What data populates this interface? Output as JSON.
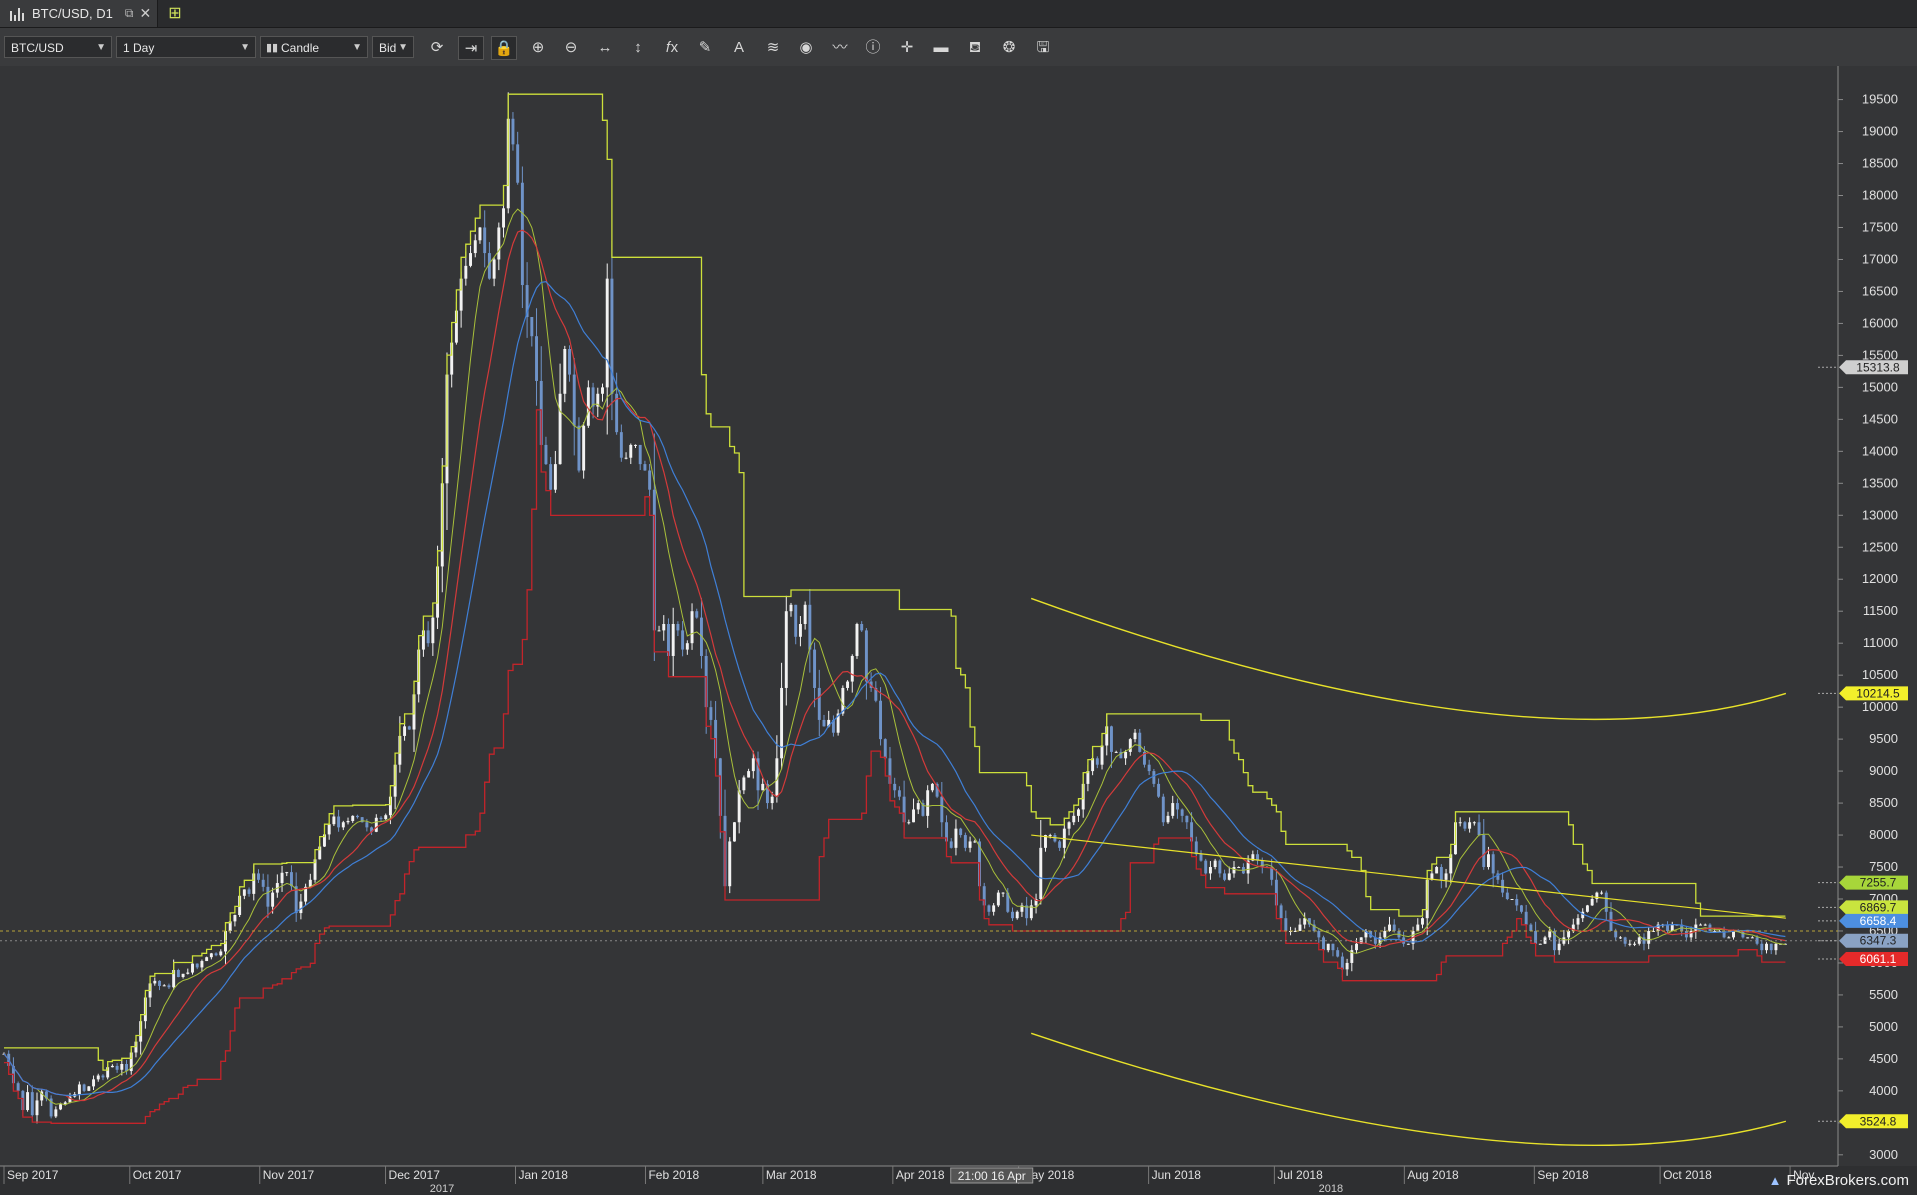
{
  "tab": {
    "title": "BTC/USD, D1",
    "icon": "candlestick-chart-icon",
    "popout_icon": "popout-icon",
    "close_icon": "close-icon"
  },
  "new_tab_icon": "add-chart-icon",
  "toolbar": {
    "symbol": "BTC/USD",
    "timeframe": "1 Day",
    "chart_type": "Candle",
    "price_side": "Bid",
    "buttons": [
      {
        "name": "refresh-icon",
        "glyph": "⟳"
      },
      {
        "name": "shift-chart-icon",
        "glyph": "⇥",
        "active": true
      },
      {
        "name": "lock-icon",
        "glyph": "🔒",
        "active": true
      },
      {
        "name": "zoom-in-icon",
        "glyph": "⊕"
      },
      {
        "name": "zoom-out-icon",
        "glyph": "⊖"
      },
      {
        "name": "fit-horizontal-icon",
        "glyph": "↔"
      },
      {
        "name": "fit-vertical-icon",
        "glyph": "↕"
      },
      {
        "name": "indicators-icon",
        "glyph": "𝑓x"
      },
      {
        "name": "drawing-pencil-icon",
        "glyph": "✎"
      },
      {
        "name": "text-tool-icon",
        "glyph": "A"
      },
      {
        "name": "layers-icon",
        "glyph": "≋"
      },
      {
        "name": "visibility-eye-icon",
        "glyph": "◉"
      },
      {
        "name": "signals-icon",
        "glyph": "〰"
      },
      {
        "name": "info-icon",
        "glyph": "ⓘ"
      },
      {
        "name": "crosshair-icon",
        "glyph": "✛"
      },
      {
        "name": "volume-bar-icon",
        "glyph": "▬"
      },
      {
        "name": "paint-bucket-icon",
        "glyph": "⛾"
      },
      {
        "name": "sync-icon",
        "glyph": "❂"
      },
      {
        "name": "save-icon",
        "glyph": "🖫"
      }
    ]
  },
  "chart_data": {
    "type": "candlestick",
    "symbol": "BTC/USD",
    "timeframe": "D1",
    "ylim": [
      2700,
      19900
    ],
    "y_ticks": [
      3000,
      3500,
      4000,
      4500,
      5000,
      5500,
      6000,
      6500,
      7000,
      7500,
      8000,
      8500,
      9000,
      9500,
      10000,
      10500,
      11000,
      11500,
      12000,
      12500,
      13000,
      13500,
      14000,
      14500,
      15000,
      15500,
      16000,
      16500,
      17000,
      17500,
      18000,
      18500,
      19000,
      19500
    ],
    "x_labels": [
      {
        "label": "Sep 2017",
        "day": 0
      },
      {
        "label": "Oct 2017",
        "day": 30
      },
      {
        "label": "Nov 2017",
        "day": 61
      },
      {
        "label": "Dec 2017",
        "day": 91
      },
      {
        "label": "Jan 2018",
        "day": 122
      },
      {
        "label": "Feb 2018",
        "day": 153
      },
      {
        "label": "Mar 2018",
        "day": 181
      },
      {
        "label": "Apr 2018",
        "day": 212
      },
      {
        "label": "May 2018",
        "day": 242
      },
      {
        "label": "Jun 2018",
        "day": 273
      },
      {
        "label": "Jul 2018",
        "day": 303
      },
      {
        "label": "Aug 2018",
        "day": 334
      },
      {
        "label": "Sep 2018",
        "day": 365
      },
      {
        "label": "Oct 2018",
        "day": 395
      },
      {
        "label": "Nov",
        "day": 426
      }
    ],
    "year_labels": [
      {
        "label": "2017",
        "day": 61
      },
      {
        "label": "2018",
        "day": 273
      }
    ],
    "crosshair_date_label": "21:00 16 Apr",
    "price_tags": [
      {
        "value": 15313.8,
        "label": "15313.8",
        "color": "#cfcfcf",
        "text": "#222"
      },
      {
        "value": 10214.5,
        "label": "10214.5",
        "color": "#f2ef2b",
        "text": "#222"
      },
      {
        "value": 7255.7,
        "label": "7255.7",
        "color": "#a7d63a",
        "text": "#222"
      },
      {
        "value": 6869.7,
        "label": "6869.7",
        "color": "#c9e43e",
        "text": "#222"
      },
      {
        "value": 6658.4,
        "label": "6658.4",
        "color": "#4d8fe0",
        "text": "#fff"
      },
      {
        "value": 6347.3,
        "label": "6347.3",
        "color": "#8aa2c4",
        "text": "#222"
      },
      {
        "value": 6061.1,
        "label": "6061.1",
        "color": "#e52a2a",
        "text": "#fff"
      },
      {
        "value": 3524.8,
        "label": "3524.8",
        "color": "#f2ef2b",
        "text": "#222"
      }
    ],
    "price_line_upper": {
      "x": [
        0,
        60,
        90,
        105,
        120,
        135,
        150,
        170,
        200,
        230,
        260,
        290,
        320,
        350,
        380,
        400,
        415,
        426
      ],
      "y": [
        4300,
        5200,
        7300,
        12500,
        15200,
        14200,
        12000,
        10800,
        8400,
        7200,
        7300,
        6500,
        6300,
        6400,
        6800,
        6900,
        7050,
        7150
      ]
    },
    "channel_upper": {
      "x0": 245,
      "x1": 425,
      "y0": 11700,
      "y_mid": 9650,
      "y1": 10214.5
    },
    "channel_lower": {
      "x0": 245,
      "x1": 425,
      "y0": 4900,
      "y_mid": 3000,
      "y1": 3524.8
    },
    "closes": [
      4580,
      4390,
      4120,
      4000,
      3700,
      3980,
      3620,
      3850,
      3990,
      3880,
      3600,
      3710,
      3790,
      3820,
      3910,
      3950,
      4100,
      4000,
      4070,
      4180,
      4240,
      4210,
      4370,
      4390,
      4330,
      4420,
      4310,
      4600,
      4770,
      5090,
      5460,
      5680,
      5720,
      5640,
      5650,
      5620,
      5890,
      5780,
      5830,
      5850,
      5990,
      5930,
      6030,
      6090,
      6150,
      6120,
      6180,
      6500,
      6650,
      6750,
      7050,
      7150,
      7080,
      7400,
      7300,
      7190,
      6880,
      7100,
      7250,
      7410,
      7420,
      7200,
      6780,
      6960,
      7190,
      7300,
      7620,
      7820,
      8010,
      8170,
      8290,
      8120,
      8200,
      8220,
      8300,
      8280,
      8200,
      8120,
      8050,
      8270,
      8250,
      8310,
      8600,
      9100,
      9550,
      9700,
      9650,
      10200,
      10900,
      11200,
      11000,
      11400,
      12200,
      13500,
      15200,
      15700,
      16200,
      16700,
      16900,
      17100,
      17300,
      17500,
      17100,
      16700,
      17000,
      17500,
      17800,
      19200,
      18800,
      18200,
      16600,
      16100,
      15800,
      15100,
      14100,
      13800,
      13400,
      13800,
      14900,
      15600,
      15200,
      14400,
      13700,
      14400,
      15000,
      14700,
      14900,
      15000,
      16700,
      14900,
      14300,
      13900,
      13900,
      14100,
      14100,
      13800,
      13700,
      13400,
      11200,
      11200,
      11300,
      10800,
      11300,
      11200,
      10900,
      11000,
      11500,
      11400,
      10800,
      10000,
      9800,
      9200,
      8300,
      7200,
      7900,
      8200,
      8700,
      8900,
      9000,
      9200,
      8700,
      8800,
      8500,
      8600,
      9200,
      10300,
      11500,
      11600,
      11100,
      11300,
      11600,
      10900,
      10300,
      9800,
      9700,
      9800,
      9600,
      9900,
      10300,
      10400,
      10800,
      11300,
      11200,
      10400,
      10300,
      10100,
      9500,
      9200,
      8800,
      8700,
      8600,
      8200,
      8200,
      8400,
      8500,
      8300,
      8700,
      8800,
      8600,
      8200,
      7900,
      7800,
      8100,
      8000,
      7800,
      7900,
      7900,
      7200,
      6900,
      6800,
      6900,
      7100,
      7100,
      6800,
      6700,
      6800,
      6900,
      6700,
      6900,
      7000,
      7800,
      8000,
      8000,
      7900,
      7800,
      8100,
      8200,
      8300,
      8400,
      8800,
      9000,
      9200,
      9100,
      9400,
      9700,
      9300,
      9300,
      9200,
      9300,
      9500,
      9600,
      9300,
      9100,
      9000,
      8800,
      8600,
      8200,
      8300,
      8500,
      8400,
      8300,
      8200,
      7900,
      7700,
      7600,
      7400,
      7500,
      7600,
      7400,
      7300,
      7400,
      7500,
      7500,
      7400,
      7600,
      7700,
      7600,
      7500,
      7500,
      7300,
      6900,
      6700,
      6500,
      6500,
      6500,
      6600,
      6700,
      6600,
      6500,
      6400,
      6200,
      6300,
      6200,
      6100,
      5900,
      6000,
      6200,
      6300,
      6400,
      6500,
      6400,
      6300,
      6400,
      6500,
      6600,
      6500,
      6400,
      6300,
      6300,
      6500,
      6600,
      6700,
      7300,
      7400,
      7500,
      7300,
      7400,
      7700,
      8200,
      8200,
      8100,
      8200,
      8200,
      8000,
      7500,
      7700,
      7400,
      7300,
      7100,
      7000,
      7000,
      6900,
      6800,
      6600,
      6500,
      6300,
      6300,
      6400,
      6500,
      6200,
      6300,
      6400,
      6500,
      6600,
      6700,
      6800,
      6900,
      7000,
      7100,
      7100,
      6800,
      6500,
      6400,
      6400,
      6300,
      6300,
      6300,
      6400,
      6300,
      6500,
      6500,
      6600,
      6600,
      6500,
      6600,
      6600,
      6500,
      6400,
      6500,
      6600,
      6600,
      6600,
      6500,
      6500,
      6500,
      6400,
      6400,
      6500,
      6500,
      6400,
      6400,
      6400,
      6300,
      6200,
      6300,
      6200,
      6300,
      6300,
      6300
    ]
  },
  "branding": {
    "text": "ForexBrokers.com",
    "icon": "forexbrokers-logo-icon"
  }
}
